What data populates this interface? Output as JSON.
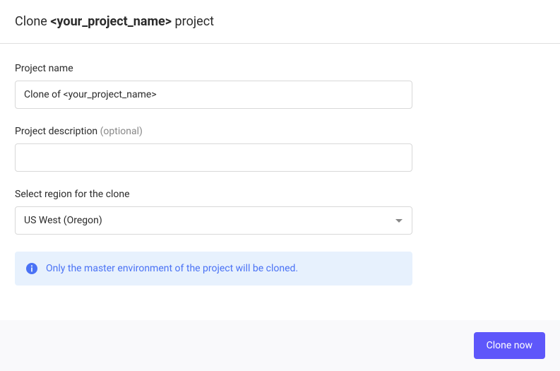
{
  "header": {
    "title_prefix": "Clone ",
    "project_name": "<your_project_name>",
    "title_suffix": " project"
  },
  "form": {
    "project_name": {
      "label": "Project name",
      "value": "Clone of <your_project_name>"
    },
    "project_description": {
      "label": "Project description ",
      "optional_text": "(optional)",
      "value": ""
    },
    "region": {
      "label": "Select region for the clone",
      "selected": "US West (Oregon)"
    }
  },
  "info_banner": {
    "message": "Only the master environment of the project will be cloned."
  },
  "footer": {
    "clone_button": "Clone now"
  }
}
